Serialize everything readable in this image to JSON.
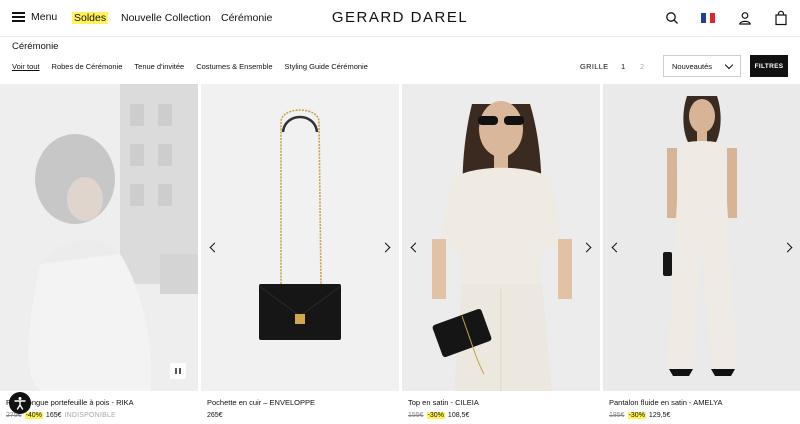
{
  "header": {
    "menu_label": "Menu",
    "nav": [
      "Soldes",
      "Nouvelle Collection",
      "Cérémonie"
    ],
    "logo": "GERARD DAREL",
    "icons": [
      "search-icon",
      "flag-france-icon",
      "user-icon",
      "bag-icon"
    ],
    "highlight_color": "#fff25a"
  },
  "page": {
    "title": "Cérémonie",
    "categories": [
      "Voir tout",
      "Robes de Cérémonie",
      "Tenue d'invitée",
      "Costumes & Ensemble",
      "Styling Guide Cérémonie"
    ],
    "active_category": "Voir tout"
  },
  "toolbar": {
    "grid_label": "GRILLE",
    "grid_options": [
      "1",
      "2"
    ],
    "sort_value": "Nouveautés",
    "filters_label": "FILTRES"
  },
  "products": [
    {
      "name": "Robe longue portefeuille à pois - RIKA",
      "price_old": "275€",
      "discount": "-40%",
      "price": "165€",
      "status": "INDISPONIBLE"
    },
    {
      "name": "Pochette en cuir – ENVELOPPE",
      "price_old": "",
      "discount": "",
      "price": "265€",
      "status": ""
    },
    {
      "name": "Top en satin - CILEIA",
      "price_old": "155€",
      "discount": "-30%",
      "price": "108,5€",
      "status": ""
    },
    {
      "name": "Pantalon fluide en satin - AMELYA",
      "price_old": "185€",
      "discount": "-30%",
      "price": "129,5€",
      "status": ""
    }
  ]
}
